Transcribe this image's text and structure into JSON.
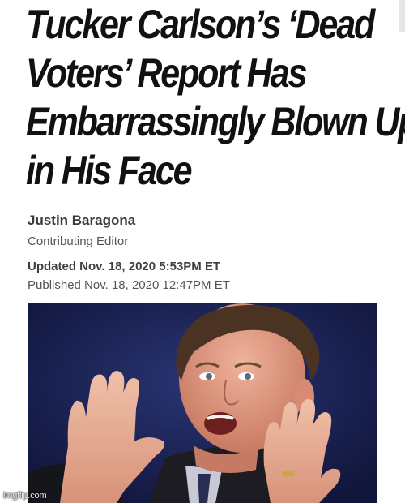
{
  "article": {
    "headline_lines": [
      "Tucker Carlson’s ‘Dead",
      "Voters’ Report Has",
      "Embarrassingly Blown Up",
      "in His Face"
    ],
    "author": "Justin Baragona",
    "author_role": "Contributing Editor",
    "updated": "Updated Nov. 18, 2020 5:53PM ET",
    "published": "Published Nov. 18, 2020 12:47PM ET"
  },
  "photo": {
    "subject": "man-raising-hands-photo",
    "background_color": "#19204a"
  },
  "watermark": "imgflip.com"
}
